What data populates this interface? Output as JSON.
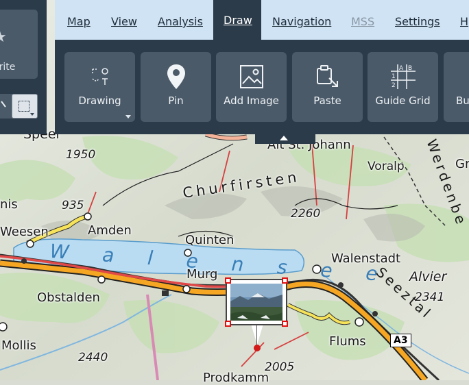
{
  "sidebar": {
    "favorite_label": "orite",
    "favorite_icon": "star-icon",
    "search_icon": "zoom-icon",
    "select_icon": "rectangle-select-icon"
  },
  "menu": {
    "items": [
      {
        "label": "Map",
        "state": "normal"
      },
      {
        "label": "View",
        "state": "normal"
      },
      {
        "label": "Analysis",
        "state": "normal"
      },
      {
        "label": "Draw",
        "state": "active"
      },
      {
        "label": "Navigation",
        "state": "normal"
      },
      {
        "label": "MSS",
        "state": "disabled"
      },
      {
        "label": "Settings",
        "state": "normal"
      },
      {
        "label": "H",
        "state": "normal"
      }
    ]
  },
  "ribbon": {
    "tools": [
      {
        "label": "Drawing",
        "icon": "drawing-shapes-icon"
      },
      {
        "label": "Pin",
        "icon": "map-pin-icon"
      },
      {
        "label": "Add Image",
        "icon": "image-icon"
      },
      {
        "label": "Paste",
        "icon": "paste-clipboard-icon"
      },
      {
        "label": "Guide Grid",
        "icon": "guide-grid-icon"
      },
      {
        "label": "Bu",
        "icon": "button-icon"
      }
    ],
    "grid_icon_letters": [
      "A",
      "B",
      "1",
      "2"
    ]
  },
  "map": {
    "lake": "W a l e n s e e",
    "range": "Churfirsten",
    "seeztal": "Seeztal",
    "werdenberg": "Werdenbe",
    "places": {
      "alt_st_johann": "Alt St. Johann",
      "voralp": "Voralp",
      "amden": "Amden",
      "quinten": "Quinten",
      "walenstadt": "Walenstadt",
      "weesen": "Weesen",
      "murg": "Murg",
      "obstalden": "Obstalden",
      "flums": "Flums",
      "mollis": "Mollis",
      "prodkamm": "Prodkamm",
      "alvier": "Alvier",
      "nis": "nis",
      "gr": "Gr",
      "speer": "Speer"
    },
    "elevations": {
      "e1950": "1950",
      "e935": "935",
      "e2260": "2260",
      "e2341": "2341",
      "e2440": "2440",
      "e2005": "2005"
    },
    "road_shield": "A3"
  },
  "colors": {
    "toolbar_bg": "#2c3b4a",
    "tool_button_bg": "#4b5a69",
    "menu_bar_bg": "#cfe3f4",
    "lake": "#b9dcf2",
    "motorway": "#f5a623",
    "selection_handle": "#e01010"
  }
}
